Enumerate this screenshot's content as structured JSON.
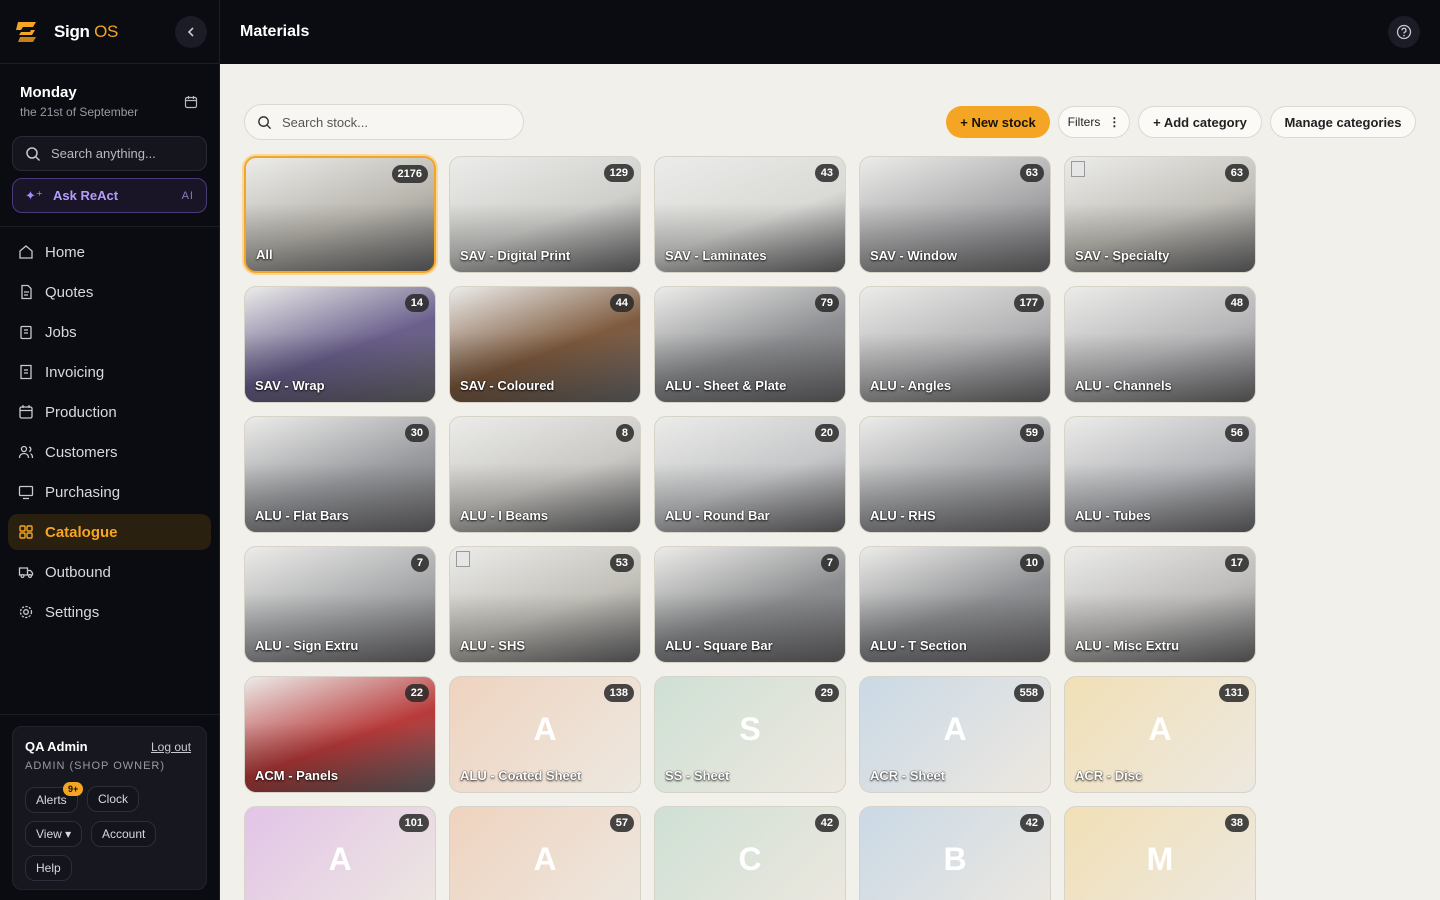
{
  "app": {
    "name_main": "Sign",
    "name_accent": "OS"
  },
  "date": {
    "day": "Monday",
    "sub": "the 21st of September"
  },
  "sidebar": {
    "search_placeholder": "Search anything...",
    "ask_label": "Ask ReAct",
    "ask_tag": "AI",
    "nav": [
      {
        "label": "Home",
        "icon": "home-icon"
      },
      {
        "label": "Quotes",
        "icon": "document-icon"
      },
      {
        "label": "Jobs",
        "icon": "clipboard-icon"
      },
      {
        "label": "Invoicing",
        "icon": "receipt-icon"
      },
      {
        "label": "Production",
        "icon": "calendar-icon"
      },
      {
        "label": "Customers",
        "icon": "users-icon"
      },
      {
        "label": "Purchasing",
        "icon": "monitor-icon"
      },
      {
        "label": "Catalogue",
        "icon": "grid-icon",
        "active": true
      },
      {
        "label": "Outbound",
        "icon": "truck-icon"
      },
      {
        "label": "Settings",
        "icon": "gear-icon"
      }
    ],
    "user": {
      "name": "QA Admin",
      "logout": "Log out",
      "role": "ADMIN (SHOP OWNER)",
      "alerts": "Alerts",
      "alerts_badge": "9+",
      "clock": "Clock",
      "view": "View ▾",
      "account": "Account",
      "help": "Help"
    }
  },
  "header": {
    "title": "Materials"
  },
  "toolbar": {
    "search_placeholder": "Search stock...",
    "new_stock": "+ New stock",
    "filters": "Filters",
    "add_category": "+ Add category",
    "manage_categories": "Manage categories"
  },
  "categories": [
    {
      "label": "All",
      "count": "2176",
      "bg": "#b9b6ae"
    },
    {
      "label": "SAV - Digital Print",
      "count": "129",
      "bg": "#cfd0cc"
    },
    {
      "label": "SAV - Laminates",
      "count": "43",
      "bg": "#d9d9d6"
    },
    {
      "label": "SAV - Window",
      "count": "63",
      "bg": "#a9a9ab"
    },
    {
      "label": "SAV - Specialty",
      "count": "63",
      "bg": "#c2c0b9"
    },
    {
      "label": "SAV - Wrap",
      "count": "14",
      "bg": "#6a5f8c"
    },
    {
      "label": "SAV - Coloured",
      "count": "44",
      "bg": "#7e5a3e"
    },
    {
      "label": "ALU - Sheet & Plate",
      "count": "79",
      "bg": "#8e8f92"
    },
    {
      "label": "ALU - Angles",
      "count": "177",
      "bg": "#b3b3b5"
    },
    {
      "label": "ALU - Channels",
      "count": "48",
      "bg": "#b6b6b8"
    },
    {
      "label": "ALU - Flat Bars",
      "count": "30",
      "bg": "#9b9ca0"
    },
    {
      "label": "ALU - I Beams",
      "count": "8",
      "bg": "#c9c8c4"
    },
    {
      "label": "ALU - Round Bar",
      "count": "20",
      "bg": "#c5c6c8"
    },
    {
      "label": "ALU - RHS",
      "count": "59",
      "bg": "#a4a5a8"
    },
    {
      "label": "ALU - Tubes",
      "count": "56",
      "bg": "#b5b6ba"
    },
    {
      "label": "ALU - Sign Extru",
      "count": "7",
      "bg": "#a7a8aa"
    },
    {
      "label": "ALU - SHS",
      "count": "53",
      "bg": "#c2c0b9"
    },
    {
      "label": "ALU - Square Bar",
      "count": "7",
      "bg": "#8d8e90"
    },
    {
      "label": "ALU - T Section",
      "count": "10",
      "bg": "#8f9093"
    },
    {
      "label": "ALU - Misc Extru",
      "count": "17",
      "bg": "#bdbcba"
    },
    {
      "label": "ACM - Panels",
      "count": "22",
      "bg": "#b83a3a"
    },
    {
      "label": "ALU - Coated Sheet",
      "count": "138",
      "letter": "A",
      "bg": "#efd3bf"
    },
    {
      "label": "SS - Sheet",
      "count": "29",
      "letter": "S",
      "bg": "#cfe0d4"
    },
    {
      "label": "ACR - Sheet",
      "count": "558",
      "letter": "A",
      "bg": "#cad9e6"
    },
    {
      "label": "ACR - Disc",
      "count": "131",
      "letter": "A",
      "bg": "#f1e0b6"
    },
    {
      "label": "",
      "count": "101",
      "letter": "A",
      "bg": "#e3c4e8"
    },
    {
      "label": "",
      "count": "57",
      "letter": "A",
      "bg": "#efd3bf"
    },
    {
      "label": "",
      "count": "42",
      "letter": "C",
      "bg": "#cfe0d4"
    },
    {
      "label": "",
      "count": "42",
      "letter": "B",
      "bg": "#cad9e6"
    },
    {
      "label": "",
      "count": "38",
      "letter": "M",
      "bg": "#f1e0b6"
    }
  ],
  "colors": {
    "accent": "#f5a524",
    "sidebar_bg": "#0b0b12",
    "page_bg": "#f2f0eb"
  }
}
